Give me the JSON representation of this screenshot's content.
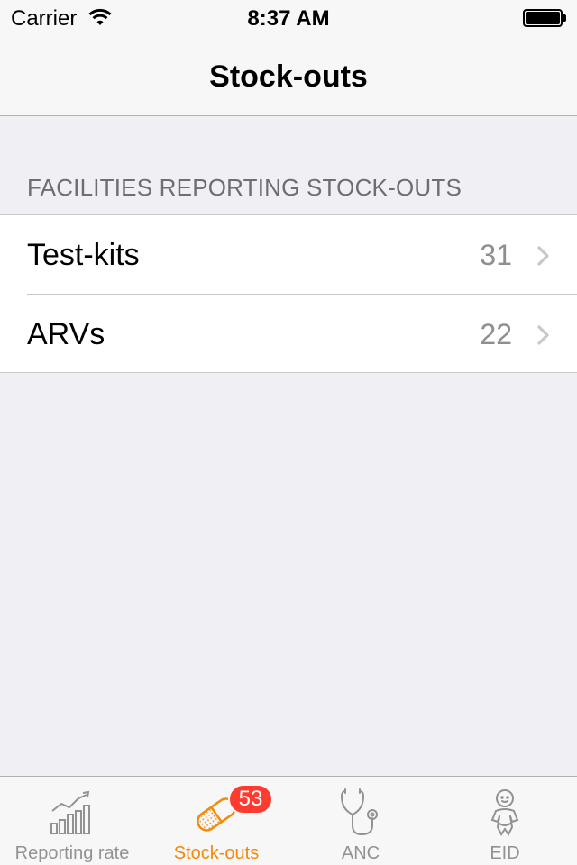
{
  "status_bar": {
    "carrier": "Carrier",
    "time": "8:37 AM"
  },
  "navigation": {
    "title": "Stock-outs"
  },
  "section": {
    "header": "FACILITIES REPORTING STOCK-OUTS",
    "rows": [
      {
        "label": "Test-kits",
        "value": "31"
      },
      {
        "label": "ARVs",
        "value": "22"
      }
    ]
  },
  "tab_bar": {
    "items": [
      {
        "label": "Reporting rate",
        "icon": "bar-chart-trend-icon",
        "active": false
      },
      {
        "label": "Stock-outs",
        "icon": "pill-icon",
        "active": true,
        "badge": "53"
      },
      {
        "label": "ANC",
        "icon": "stethoscope-icon",
        "active": false
      },
      {
        "label": "EID",
        "icon": "baby-icon",
        "active": false
      }
    ]
  },
  "colors": {
    "accent": "#f28a0c",
    "badge": "#ff3b30",
    "inactive_tab": "#929292",
    "background": "#efeff4"
  }
}
